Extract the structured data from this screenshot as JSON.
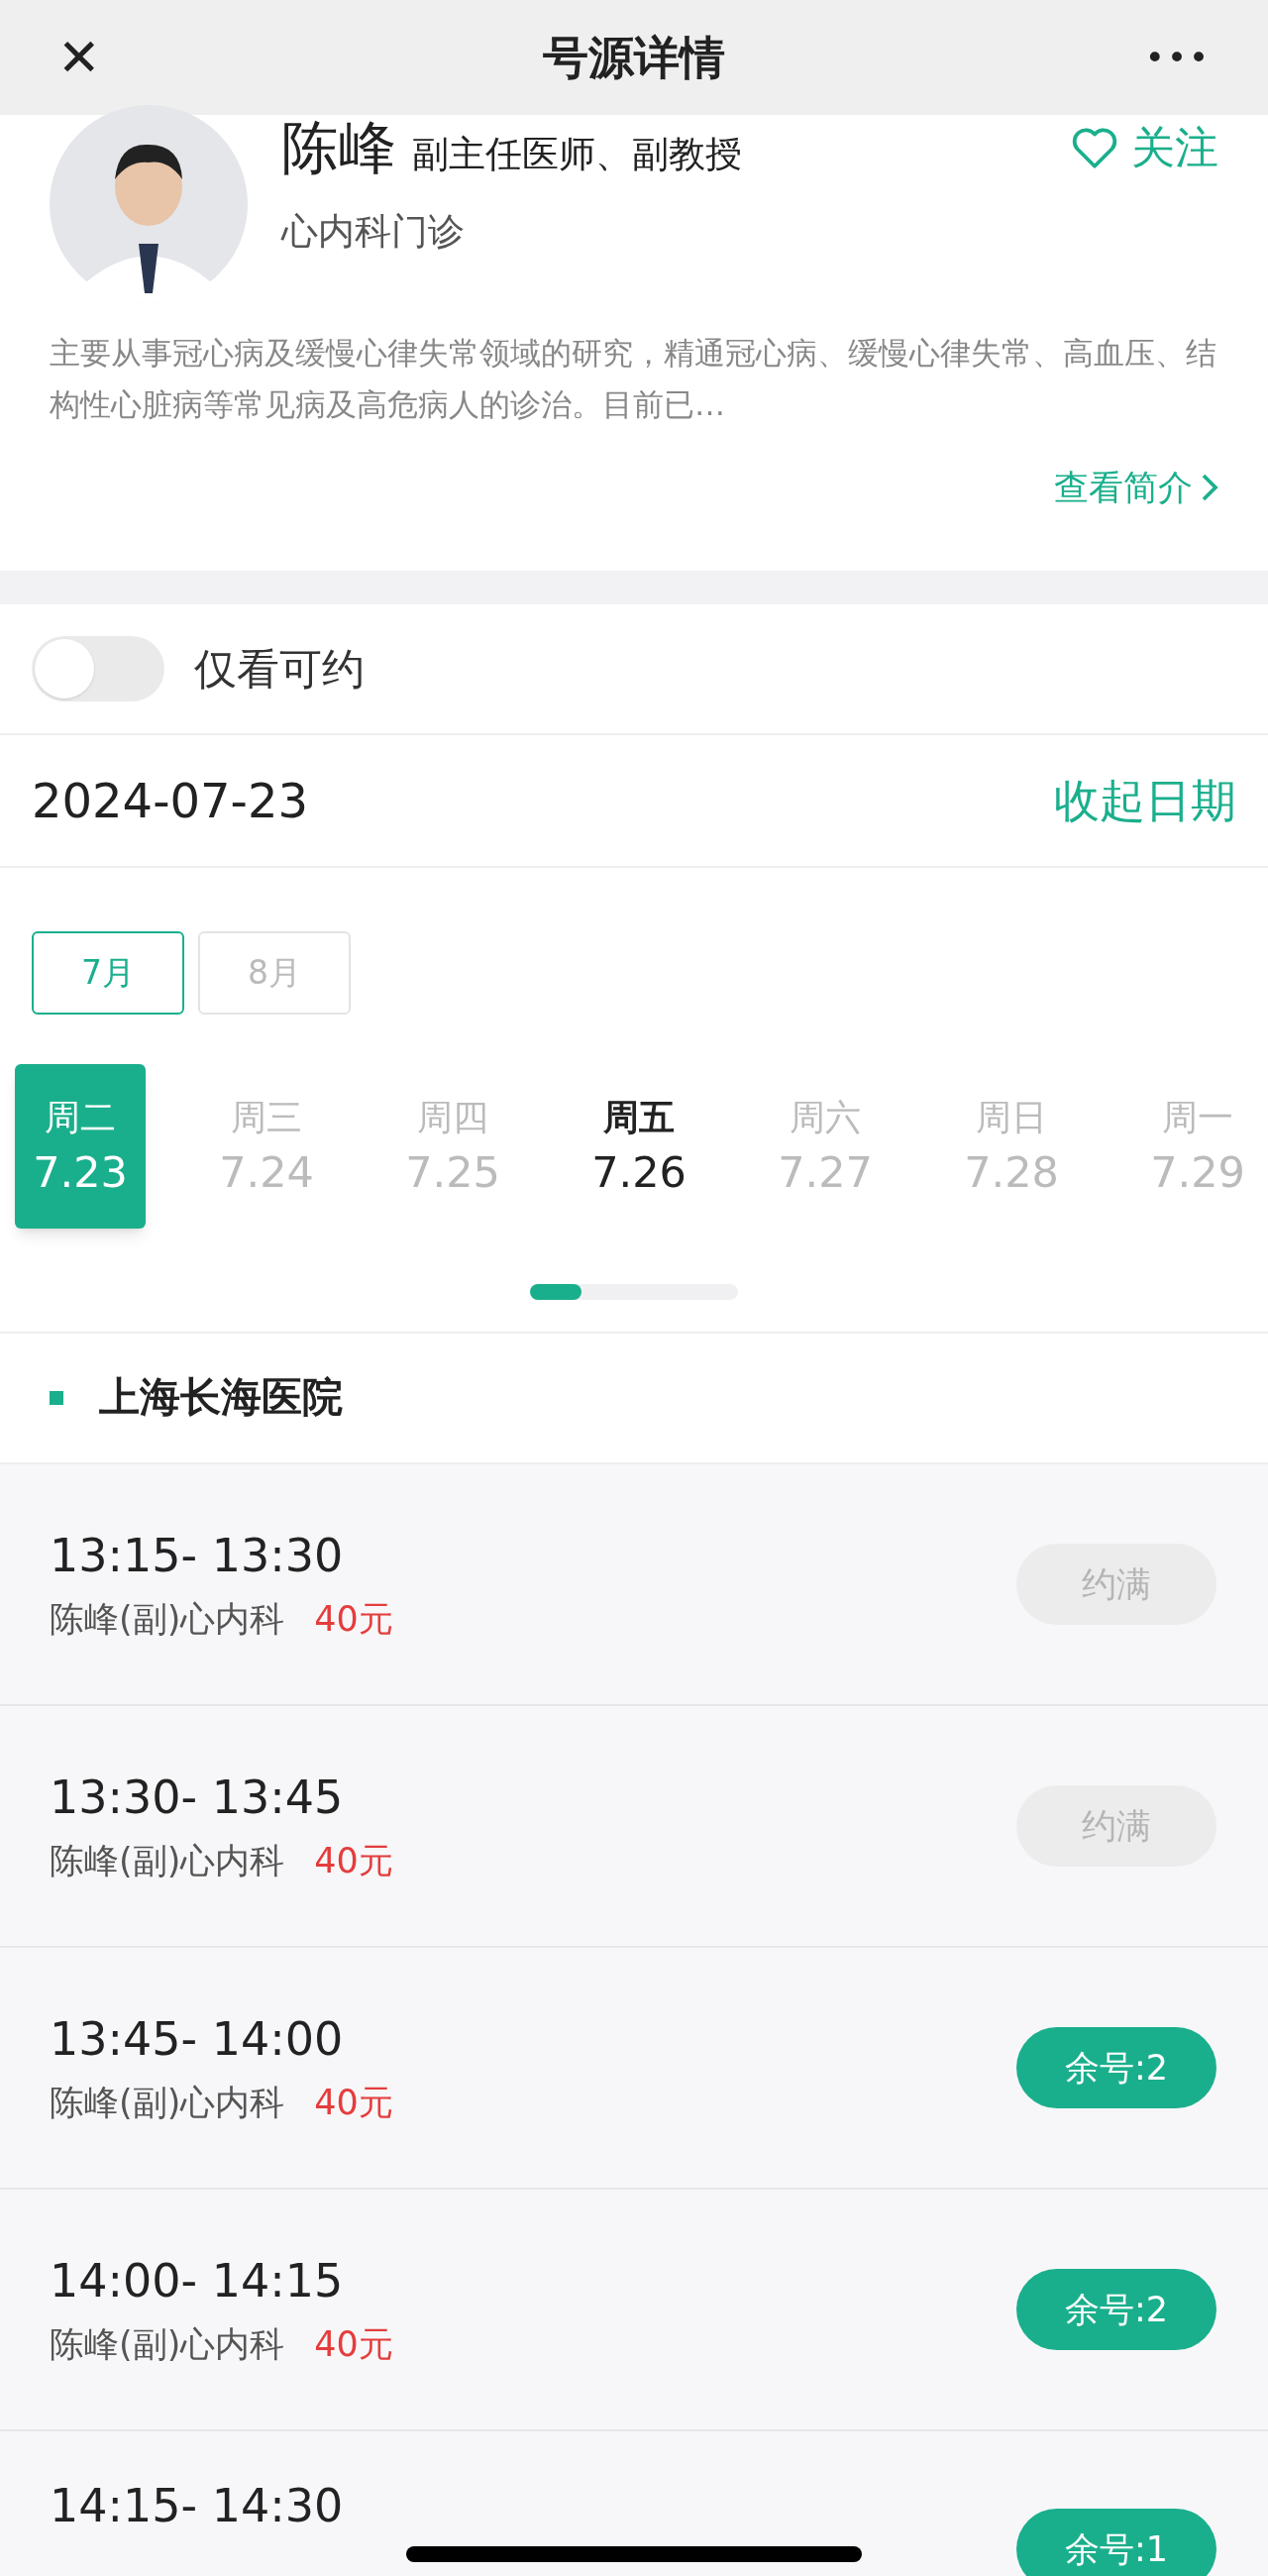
{
  "header": {
    "close": "✕",
    "title": "号源详情",
    "more": "•••"
  },
  "doctor": {
    "name": "陈峰",
    "title": "副主任医师、副教授",
    "department": "心内科门诊",
    "follow": {
      "label": "关注",
      "selected": false
    },
    "bio": "主要从事冠心病及缓慢心律失常领域的研究，精通冠心病、缓慢心律失常、高血压、结构性心脏病等常见病及高危病人的诊治。目前已…",
    "more_link": "查看简介"
  },
  "filter": {
    "label": "仅看可约",
    "on": false
  },
  "date_bar": {
    "date": "2024-07-23",
    "collapse": "收起日期"
  },
  "months": [
    {
      "label": "7月",
      "selected": true
    },
    {
      "label": "8月",
      "selected": false
    }
  ],
  "days": [
    {
      "weekday": "周二",
      "date": "7.23",
      "selected": true,
      "available": true
    },
    {
      "weekday": "周三",
      "date": "7.24",
      "selected": false,
      "available": false
    },
    {
      "weekday": "周四",
      "date": "7.25",
      "selected": false,
      "available": false
    },
    {
      "weekday": "周五",
      "date": "7.26",
      "selected": false,
      "available": true
    },
    {
      "weekday": "周六",
      "date": "7.27",
      "selected": false,
      "available": false
    },
    {
      "weekday": "周日",
      "date": "7.28",
      "selected": false,
      "available": false
    },
    {
      "weekday": "周一",
      "date": "7.29",
      "selected": false,
      "available": false
    }
  ],
  "hospital": "上海长海医院",
  "slots": [
    {
      "time": "13:15- 13:30",
      "doctor": "陈峰(副)心内科",
      "price": "40元",
      "button": "约满",
      "disabled": true
    },
    {
      "time": "13:30- 13:45",
      "doctor": "陈峰(副)心内科",
      "price": "40元",
      "button": "约满",
      "disabled": true
    },
    {
      "time": "13:45- 14:00",
      "doctor": "陈峰(副)心内科",
      "price": "40元",
      "button": "余号:2",
      "disabled": false
    },
    {
      "time": "14:00- 14:15",
      "doctor": "陈峰(副)心内科",
      "price": "40元",
      "button": "余号:2",
      "disabled": false
    },
    {
      "time": "14:15- 14:30",
      "button": "余号:1",
      "disabled": false
    }
  ]
}
